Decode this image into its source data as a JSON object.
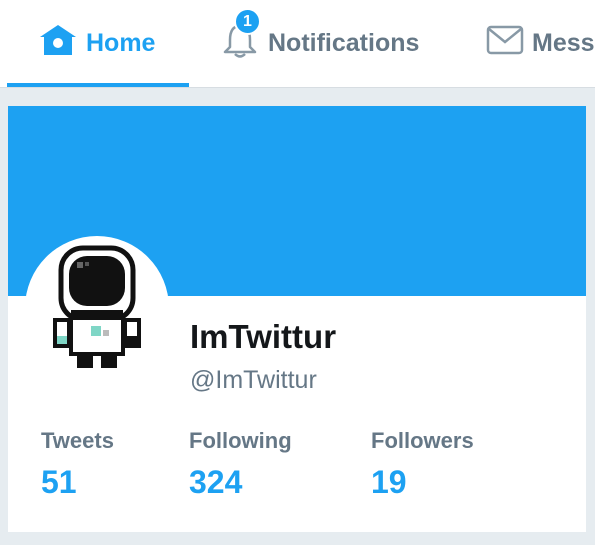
{
  "nav": {
    "home_label": "Home",
    "notifications_label": "Notifications",
    "notifications_badge": "1",
    "messages_label": "Messages"
  },
  "profile": {
    "name": "ImTwittur",
    "handle": "@ImTwittur"
  },
  "stats": [
    {
      "label": "Tweets",
      "value": "51"
    },
    {
      "label": "Following",
      "value": "324"
    },
    {
      "label": "Followers",
      "value": "19"
    }
  ],
  "colors": {
    "accent": "#1da1f2",
    "muted": "#657786",
    "background": "#e6ecf0"
  },
  "icons": {
    "home": "home-icon",
    "notifications": "bell-icon",
    "messages": "envelope-icon"
  }
}
